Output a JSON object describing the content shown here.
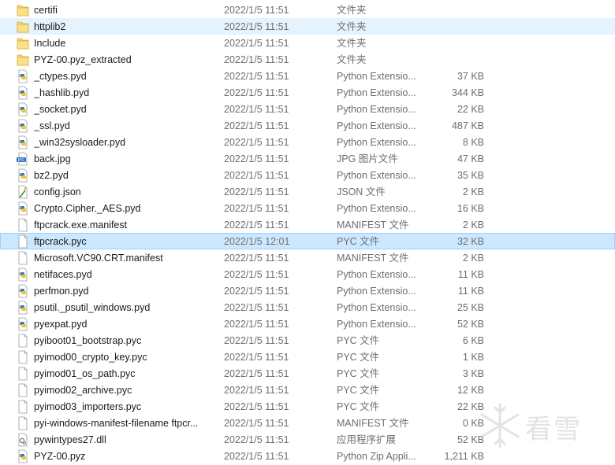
{
  "files": [
    {
      "name": "certifi",
      "date": "2022/1/5 11:51",
      "type": "文件夹",
      "size": "",
      "icon": "folder-icon"
    },
    {
      "name": "httplib2",
      "date": "2022/1/5 11:51",
      "type": "文件夹",
      "size": "",
      "icon": "folder-icon"
    },
    {
      "name": "Include",
      "date": "2022/1/5 11:51",
      "type": "文件夹",
      "size": "",
      "icon": "folder-icon"
    },
    {
      "name": "PYZ-00.pyz_extracted",
      "date": "2022/1/5 11:51",
      "type": "文件夹",
      "size": "",
      "icon": "folder-icon"
    },
    {
      "name": "_ctypes.pyd",
      "date": "2022/1/5 11:51",
      "type": "Python Extensio...",
      "size": "37 KB",
      "icon": "python-file-icon"
    },
    {
      "name": "_hashlib.pyd",
      "date": "2022/1/5 11:51",
      "type": "Python Extensio...",
      "size": "344 KB",
      "icon": "python-file-icon"
    },
    {
      "name": "_socket.pyd",
      "date": "2022/1/5 11:51",
      "type": "Python Extensio...",
      "size": "22 KB",
      "icon": "python-file-icon"
    },
    {
      "name": "_ssl.pyd",
      "date": "2022/1/5 11:51",
      "type": "Python Extensio...",
      "size": "487 KB",
      "icon": "python-file-icon"
    },
    {
      "name": "_win32sysloader.pyd",
      "date": "2022/1/5 11:51",
      "type": "Python Extensio...",
      "size": "8 KB",
      "icon": "python-file-icon"
    },
    {
      "name": "back.jpg",
      "date": "2022/1/5 11:51",
      "type": "JPG 图片文件",
      "size": "47 KB",
      "icon": "jpg-file-icon"
    },
    {
      "name": "bz2.pyd",
      "date": "2022/1/5 11:51",
      "type": "Python Extensio...",
      "size": "35 KB",
      "icon": "python-file-icon"
    },
    {
      "name": "config.json",
      "date": "2022/1/5 11:51",
      "type": "JSON 文件",
      "size": "2 KB",
      "icon": "json-file-icon"
    },
    {
      "name": "Crypto.Cipher._AES.pyd",
      "date": "2022/1/5 11:51",
      "type": "Python Extensio...",
      "size": "16 KB",
      "icon": "python-file-icon"
    },
    {
      "name": "ftpcrack.exe.manifest",
      "date": "2022/1/5 11:51",
      "type": "MANIFEST 文件",
      "size": "2 KB",
      "icon": "blank-file-icon"
    },
    {
      "name": "ftpcrack.pyc",
      "date": "2022/1/5 12:01",
      "type": "PYC 文件",
      "size": "32 KB",
      "icon": "blank-file-icon"
    },
    {
      "name": "Microsoft.VC90.CRT.manifest",
      "date": "2022/1/5 11:51",
      "type": "MANIFEST 文件",
      "size": "2 KB",
      "icon": "blank-file-icon"
    },
    {
      "name": "netifaces.pyd",
      "date": "2022/1/5 11:51",
      "type": "Python Extensio...",
      "size": "11 KB",
      "icon": "python-file-icon"
    },
    {
      "name": "perfmon.pyd",
      "date": "2022/1/5 11:51",
      "type": "Python Extensio...",
      "size": "11 KB",
      "icon": "python-file-icon"
    },
    {
      "name": "psutil._psutil_windows.pyd",
      "date": "2022/1/5 11:51",
      "type": "Python Extensio...",
      "size": "25 KB",
      "icon": "python-file-icon"
    },
    {
      "name": "pyexpat.pyd",
      "date": "2022/1/5 11:51",
      "type": "Python Extensio...",
      "size": "52 KB",
      "icon": "python-file-icon"
    },
    {
      "name": "pyiboot01_bootstrap.pyc",
      "date": "2022/1/5 11:51",
      "type": "PYC 文件",
      "size": "6 KB",
      "icon": "blank-file-icon"
    },
    {
      "name": "pyimod00_crypto_key.pyc",
      "date": "2022/1/5 11:51",
      "type": "PYC 文件",
      "size": "1 KB",
      "icon": "blank-file-icon"
    },
    {
      "name": "pyimod01_os_path.pyc",
      "date": "2022/1/5 11:51",
      "type": "PYC 文件",
      "size": "3 KB",
      "icon": "blank-file-icon"
    },
    {
      "name": "pyimod02_archive.pyc",
      "date": "2022/1/5 11:51",
      "type": "PYC 文件",
      "size": "12 KB",
      "icon": "blank-file-icon"
    },
    {
      "name": "pyimod03_importers.pyc",
      "date": "2022/1/5 11:51",
      "type": "PYC 文件",
      "size": "22 KB",
      "icon": "blank-file-icon"
    },
    {
      "name": "pyi-windows-manifest-filename ftpcr...",
      "date": "2022/1/5 11:51",
      "type": "MANIFEST 文件",
      "size": "0 KB",
      "icon": "blank-file-icon"
    },
    {
      "name": "pywintypes27.dll",
      "date": "2022/1/5 11:51",
      "type": "应用程序扩展",
      "size": "52 KB",
      "icon": "dll-file-icon"
    },
    {
      "name": "PYZ-00.pyz",
      "date": "2022/1/5 11:51",
      "type": "Python Zip Appli...",
      "size": "1,211 KB",
      "icon": "python-file-icon"
    }
  ],
  "hover_index": 1,
  "selected_index": 14,
  "watermark": {
    "text": "看雪"
  },
  "colors": {
    "hover_bg": "#e5f3ff",
    "selected_bg": "#cce8ff",
    "selected_border": "#99d1ff",
    "folder": "#f8d775",
    "secondary_text": "#6d6d6d"
  }
}
